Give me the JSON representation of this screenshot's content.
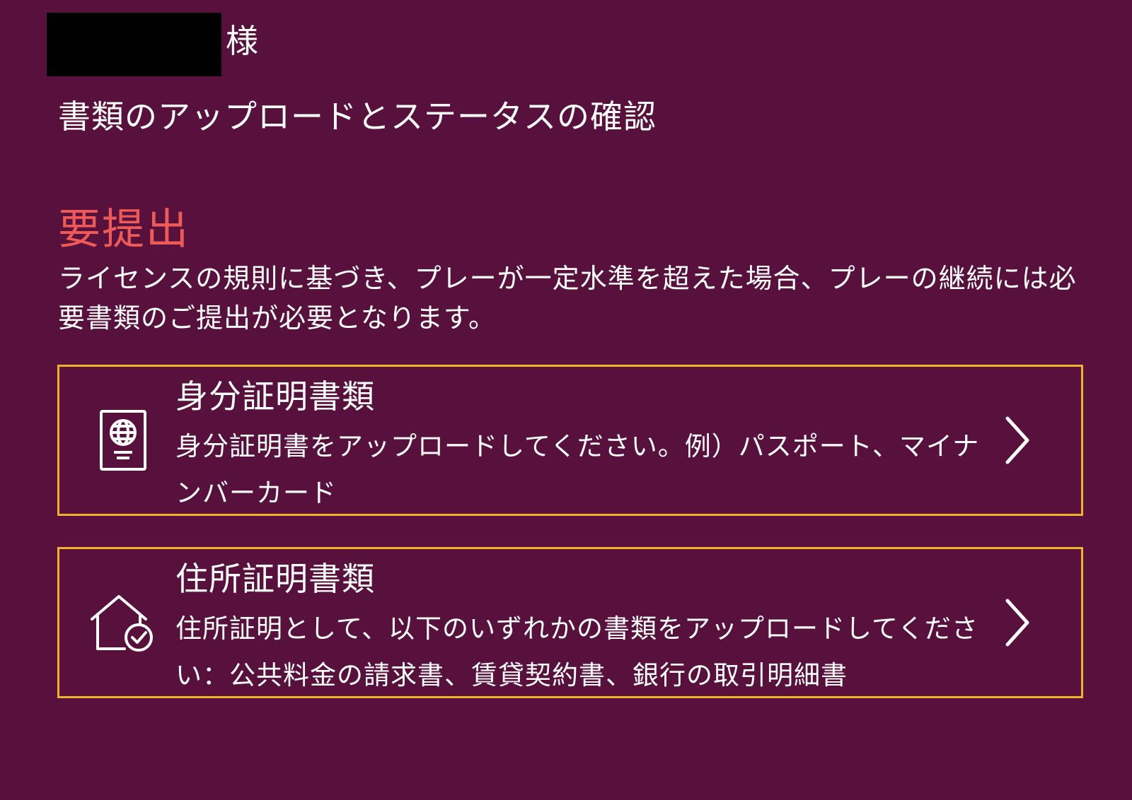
{
  "header": {
    "honorific": "様",
    "title": "書類のアップロードとステータスの確認"
  },
  "status": {
    "label": "要提出",
    "color": "#ee5a57",
    "description": "ライセンスの規則に基づき、プレーが一定水準を超えた場合、プレーの継続には必要書類のご提出が必要となります。"
  },
  "documents": [
    {
      "title": "身分証明書類",
      "description": "身分証明書をアップロードしてください。例）パスポート、マイナンバーカード",
      "icon": "passport-icon"
    },
    {
      "title": "住所証明書類",
      "description": "住所証明として、以下のいずれかの書類をアップロードしてください：公共料金の請求書、賃貸契約書、銀行の取引明細書",
      "icon": "house-check-icon"
    }
  ],
  "colors": {
    "background": "#58103c",
    "card_border": "#eeb32a",
    "text": "#ffffff"
  }
}
